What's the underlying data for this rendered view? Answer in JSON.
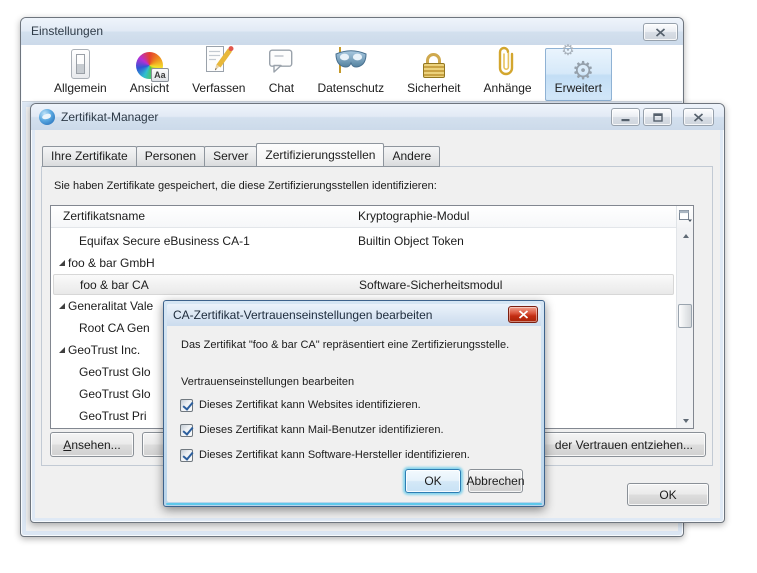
{
  "colors": {
    "dialog_close_red": "#c22c12",
    "focus_glow_blue": "#5fc8ea",
    "titlebar_blue": "#d3e0ee",
    "selected_row_gray": "#e9e9e9",
    "toolbar_selected_blue": "#c3def5"
  },
  "settings_window": {
    "title": "Einstellungen",
    "toolbar": {
      "items": [
        {
          "label": "Allgemein",
          "icon": "light-switch-icon",
          "selected": false
        },
        {
          "label": "Ansicht",
          "icon": "color-wheel-icon",
          "badge": "Aa",
          "selected": false
        },
        {
          "label": "Verfassen",
          "icon": "compose-icon",
          "selected": false
        },
        {
          "label": "Chat",
          "icon": "chat-bubble-icon",
          "selected": false
        },
        {
          "label": "Datenschutz",
          "icon": "mask-icon",
          "selected": false
        },
        {
          "label": "Sicherheit",
          "icon": "padlock-icon",
          "selected": false
        },
        {
          "label": "Anhänge",
          "icon": "paperclip-icon",
          "selected": false
        },
        {
          "label": "Erweitert",
          "icon": "gears-icon",
          "selected": true
        }
      ]
    }
  },
  "cert_manager": {
    "title": "Zertifikat-Manager",
    "tabs": [
      {
        "label": "Ihre Zertifikate",
        "active": false
      },
      {
        "label": "Personen",
        "active": false
      },
      {
        "label": "Server",
        "active": false
      },
      {
        "label": "Zertifizierungsstellen",
        "active": true
      },
      {
        "label": "Andere",
        "active": false
      }
    ],
    "description": "Sie haben Zertifikate gespeichert, die diese Zertifizierungsstellen identifizieren:",
    "table": {
      "columns": [
        "Zertifikatsname",
        "Kryptographie-Modul"
      ],
      "rows": [
        {
          "name": "Equifax Secure eBusiness CA-1",
          "module": "Builtin Object Token",
          "type": "child",
          "selected": false
        },
        {
          "name": "foo & bar GmbH",
          "module": "",
          "type": "group",
          "selected": false
        },
        {
          "name": "foo & bar CA",
          "module": "Software-Sicherheitsmodul",
          "type": "child",
          "selected": true
        },
        {
          "name": "Generalitat Vale",
          "module": "",
          "type": "group",
          "selected": false
        },
        {
          "name": "Root CA Gen",
          "module": "",
          "type": "child",
          "selected": false
        },
        {
          "name": "GeoTrust Inc.",
          "module": "",
          "type": "group",
          "selected": false
        },
        {
          "name": "GeoTrust Glo",
          "module": "",
          "type": "child",
          "selected": false
        },
        {
          "name": "GeoTrust Glo",
          "module": "",
          "type": "child",
          "selected": false
        },
        {
          "name": "GeoTrust Pri",
          "module": "",
          "type": "child",
          "selected": false
        }
      ]
    },
    "buttons": {
      "view_mnemonic": "A",
      "view_rest": "nsehen...",
      "revoke_visible": "der Vertrauen entziehen...",
      "ok": "OK"
    }
  },
  "trust_dialog": {
    "title": "CA-Zertifikat-Vertrauenseinstellungen bearbeiten",
    "intro": "Das Zertifikat \"foo & bar CA\" repräsentiert eine Zertifizierungsstelle.",
    "section_label": "Vertrauenseinstellungen bearbeiten",
    "checkboxes": [
      {
        "label": "Dieses Zertifikat kann Websites identifizieren.",
        "checked": true
      },
      {
        "label": "Dieses Zertifikat kann Mail-Benutzer identifizieren.",
        "checked": true
      },
      {
        "label": "Dieses Zertifikat kann Software-Hersteller identifizieren.",
        "checked": true
      }
    ],
    "ok_label": "OK",
    "cancel_label": "Abbrechen"
  }
}
